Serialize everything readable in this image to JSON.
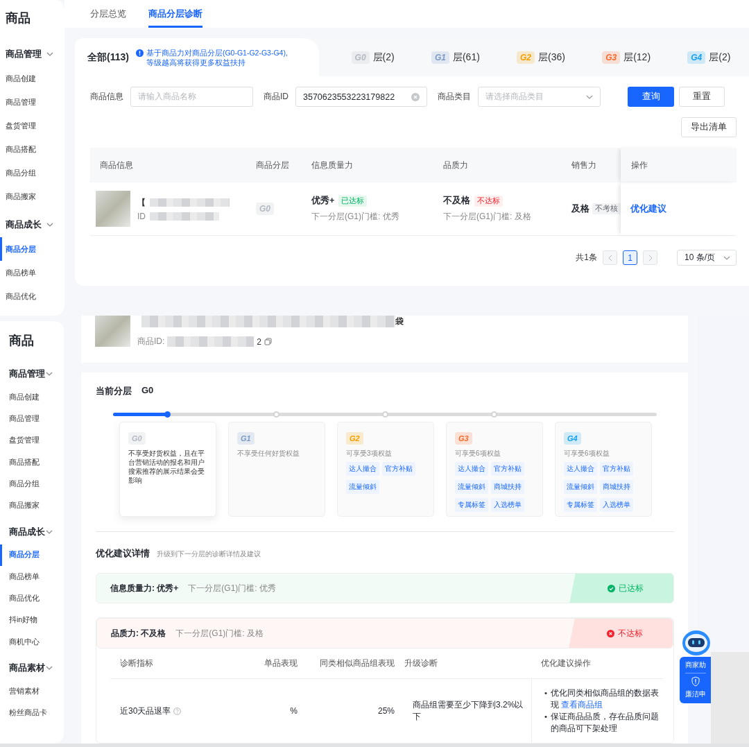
{
  "top": {
    "sidebar": {
      "title": "商品",
      "groups": [
        {
          "label": "商品管理",
          "expanded": true,
          "items": [
            {
              "label": "商品创建",
              "selected": false
            },
            {
              "label": "商品管理",
              "selected": false
            },
            {
              "label": "盘货管理",
              "selected": false
            },
            {
              "label": "商品搭配",
              "selected": false
            },
            {
              "label": "商品分组",
              "selected": false
            },
            {
              "label": "商品搬家",
              "selected": false
            }
          ]
        },
        {
          "label": "商品成长",
          "expanded": true,
          "items": [
            {
              "label": "商品分层",
              "selected": true
            },
            {
              "label": "商品榜单",
              "selected": false
            },
            {
              "label": "商品优化",
              "selected": false
            }
          ]
        }
      ]
    },
    "tabs": [
      {
        "label": "分层总览",
        "selected": false
      },
      {
        "label": "商品分层诊断",
        "selected": true
      }
    ],
    "all_tab": {
      "label": "全部(113)",
      "selected": true
    },
    "notice": "基于商品力对商品分层(G0-G1-G2-G3-G4),\n等级越高将获得更多权益扶持",
    "tier_tabs": [
      {
        "badge": "G0",
        "label": "层(2)",
        "color": "#b4b9c2",
        "selected": false
      },
      {
        "badge": "G1",
        "label": "层(61)",
        "color": "#7b9bc4",
        "selected": false
      },
      {
        "badge": "G2",
        "label": "层(36)",
        "color": "#f59e00",
        "selected": false
      },
      {
        "badge": "G3",
        "label": "层(12)",
        "color": "#f86a2a",
        "selected": false
      },
      {
        "badge": "G4",
        "label": "层(2)",
        "color": "#14a0f0",
        "selected": false
      }
    ],
    "filters": [
      {
        "label": "商品信息",
        "kind": "text",
        "placeholder": "请输入商品名称"
      },
      {
        "label": "商品ID",
        "kind": "text",
        "value": "3570623553223179822"
      },
      {
        "label": "商品类目",
        "kind": "select",
        "placeholder": "请选择商品类目"
      }
    ],
    "buttons": [
      {
        "label": "查询",
        "kind": "primary"
      },
      {
        "label": "重置",
        "kind": "default"
      }
    ],
    "export_button": "导出清单",
    "table": {
      "columns": [
        "商品信息",
        "商品分层",
        "信息质量力",
        "品质力",
        "销售力",
        "操作"
      ],
      "rows": [
        {
          "title_start": "【",
          "id_prefix": "ID",
          "tier": "G0",
          "color": "#b4b9c2",
          "info": {
            "grade": "优秀+",
            "tag": "已达标",
            "passed": true,
            "threshold": "下一分层(G1)门槛: 优秀"
          },
          "quality": {
            "grade": "不及格",
            "tag": "不达标",
            "passed": false,
            "threshold": "下一分层(G1)门槛: 及格"
          },
          "sales": {
            "grade": "及格",
            "tag": "不考核",
            "assessed": false
          },
          "action": "优化建议"
        }
      ]
    },
    "pagination": {
      "total": "共1条",
      "pages": [
        {
          "label": "1",
          "selected": true
        }
      ],
      "page_size": "10 条/页"
    }
  },
  "bottom": {
    "sidebar": {
      "title": "商品",
      "groups": [
        {
          "label": "商品管理",
          "expanded": true,
          "items": [
            {
              "label": "商品创建",
              "selected": false
            },
            {
              "label": "商品管理",
              "selected": false
            },
            {
              "label": "盘货管理",
              "selected": false
            },
            {
              "label": "商品搭配",
              "selected": false
            },
            {
              "label": "商品分组",
              "selected": false
            },
            {
              "label": "商品搬家",
              "selected": false
            }
          ]
        },
        {
          "label": "商品成长",
          "expanded": true,
          "items": [
            {
              "label": "商品分层",
              "selected": true
            },
            {
              "label": "商品榜单",
              "selected": false
            },
            {
              "label": "商品优化",
              "selected": false
            },
            {
              "label": "抖in好物",
              "selected": false
            },
            {
              "label": "商机中心",
              "selected": false
            }
          ]
        },
        {
          "label": "商品素材",
          "expanded": true,
          "items": [
            {
              "label": "营销素材",
              "selected": false
            },
            {
              "label": "粉丝商品卡",
              "selected": false
            }
          ]
        }
      ]
    },
    "product": {
      "title_end": "袋",
      "id_label": "商品ID:",
      "id_end": "2"
    },
    "current_tier": {
      "label": "当前分层",
      "value": "G0"
    },
    "progress": {
      "level": 0.1
    },
    "tiers": [
      {
        "badge": "G0",
        "color": "#b4b9c2",
        "selected": true,
        "desc": "不享受好货权益，且在平台营销活动的报名和用户搜索推荐的展示结果会受影响"
      },
      {
        "badge": "G1",
        "color": "#7b9bc4",
        "selected": false,
        "desc": "不享受任何好货权益"
      },
      {
        "badge": "G2",
        "color": "#f59e00",
        "selected": false,
        "desc": "可享受3项权益",
        "benefits": [
          "达人撮合",
          "官方补贴",
          "流量倾斜"
        ]
      },
      {
        "badge": "G3",
        "color": "#f86a2a",
        "selected": false,
        "desc": "可享受6项权益",
        "benefits": [
          "达人撮合",
          "官方补贴",
          "流量倾斜",
          "商城扶持",
          "专属标签",
          "入选榜单"
        ]
      },
      {
        "badge": "G4",
        "color": "#14a0f0",
        "selected": false,
        "desc": "可享受6项权益",
        "benefits": [
          "达人撮合",
          "官方补贴",
          "流量倾斜",
          "商城扶持",
          "专属标签",
          "入选榜单"
        ]
      }
    ],
    "details": {
      "title": "优化建议详情",
      "subtitle": "升级到下一分层的诊断详情及建议",
      "sections": [
        {
          "label": "信息质量力: 优秀+",
          "threshold": "下一分层(G1)门槛: 优秀",
          "passed": true,
          "status_label": "已达标"
        },
        {
          "label": "品质力: 不及格",
          "threshold": "下一分层(G1)门槛: 及格",
          "passed": false,
          "status_label": "不达标",
          "table": {
            "columns": [
              "诊断指标",
              "单品表现",
              "同类相似商品组表现",
              "升级诊断",
              "优化建议操作"
            ],
            "rows": [
              {
                "metric": "近30天品退率",
                "single": "%",
                "group": "25%",
                "diagnosis": "商品组需要至少下降到3.2%以下",
                "suggestions": [
                  {
                    "marker": "•",
                    "text": "优化同类相似商品组的数据表现",
                    "link": "查看商品组"
                  },
                  {
                    "marker": "•",
                    "text": "保证商品品质，存在品质问题的商品可下架处理"
                  }
                ]
              }
            ]
          }
        }
      ]
    },
    "assistant": {
      "label": "商家助",
      "report": "廉洁申"
    }
  }
}
